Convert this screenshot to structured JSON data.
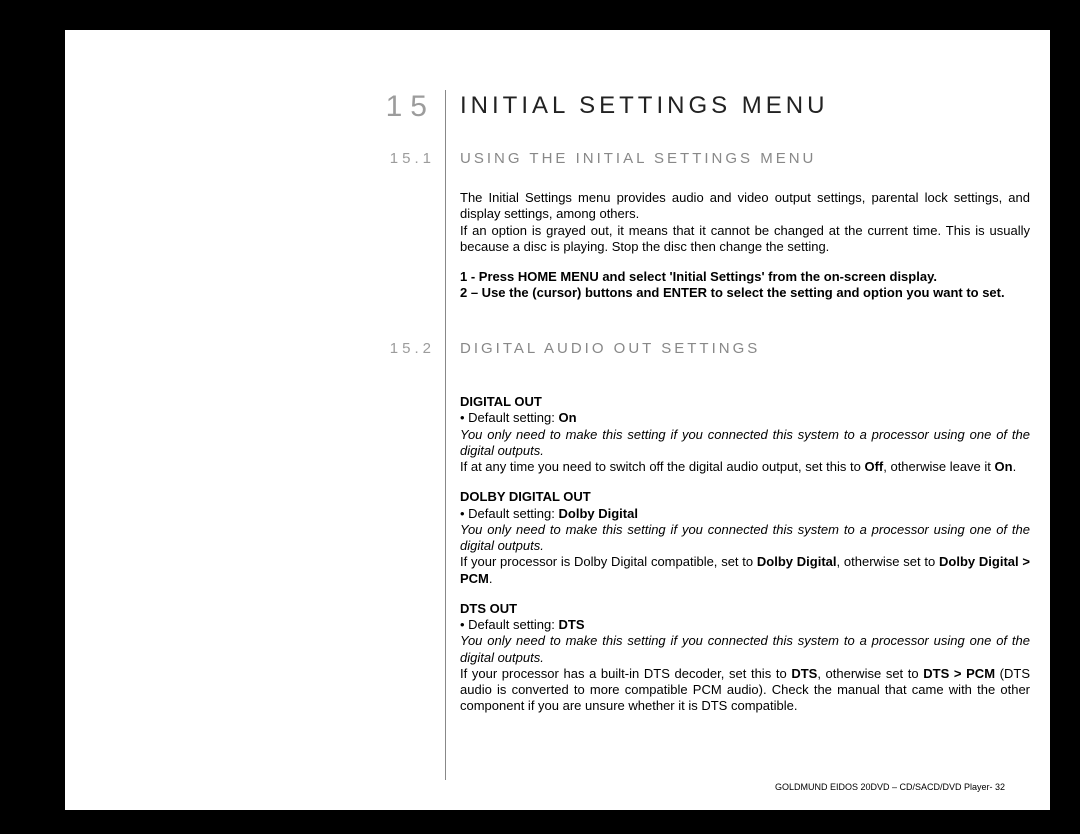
{
  "chapter": {
    "num": "15",
    "title": "INITIAL SETTINGS MENU"
  },
  "sec1": {
    "num": "15.1",
    "title": "USING THE INITIAL SETTINGS MENU",
    "p1": "The Initial Settings menu provides audio and video output settings, parental lock settings, and display settings, among others.",
    "p2": "If an option is grayed out, it means that it cannot be changed at the current time. This is usually because a disc is playing. Stop the disc then change the setting.",
    "step1": "1 - Press HOME MENU and select 'Initial Settings' from the on-screen display.",
    "step2": "2 – Use the (cursor) buttons and ENTER to select the setting and option you want to set."
  },
  "sec2": {
    "num": "15.2",
    "title": "DIGITAL AUDIO OUT SETTINGS",
    "digital_out": {
      "h": "DIGITAL OUT",
      "bullet_pre": "• Default setting: ",
      "bullet_val": "On",
      "note": "You only need to make this setting if you connected this system to a processor using one of the digital outputs.",
      "body_a": "If at any time you need to switch off the digital audio output, set this to ",
      "off": "Off",
      "body_b": ", otherwise leave it ",
      "on": "On",
      "body_c": "."
    },
    "dolby": {
      "h": "DOLBY DIGITAL OUT",
      "bullet_pre": "• Default setting: ",
      "bullet_val": "Dolby Digital",
      "note": "You only need to make this setting if you connected this system to a processor using one of the digital outputs.",
      "body_a": "If your processor is Dolby Digital compatible, set to ",
      "dd": "Dolby Digital",
      "body_b": ", otherwise set to ",
      "ddpcm": "Dolby Digital > PCM",
      "body_c": "."
    },
    "dts": {
      "h": "DTS OUT",
      "bullet_pre": "• Default setting: ",
      "bullet_val": "DTS",
      "note": "You only need to make this setting if you connected this system to a processor using one of the digital outputs.",
      "body_a": "If your processor has a built-in DTS decoder, set this to ",
      "dts": "DTS",
      "body_b": ", otherwise set to ",
      "dtspcm": "DTS > PCM",
      "body_c": " (DTS audio is converted to more compatible PCM audio). Check the manual that came with the other component if you are unsure whether it is DTS compatible."
    }
  },
  "footer": "GOLDMUND EIDOS 20DVD – CD/SACD/DVD Player- 32"
}
